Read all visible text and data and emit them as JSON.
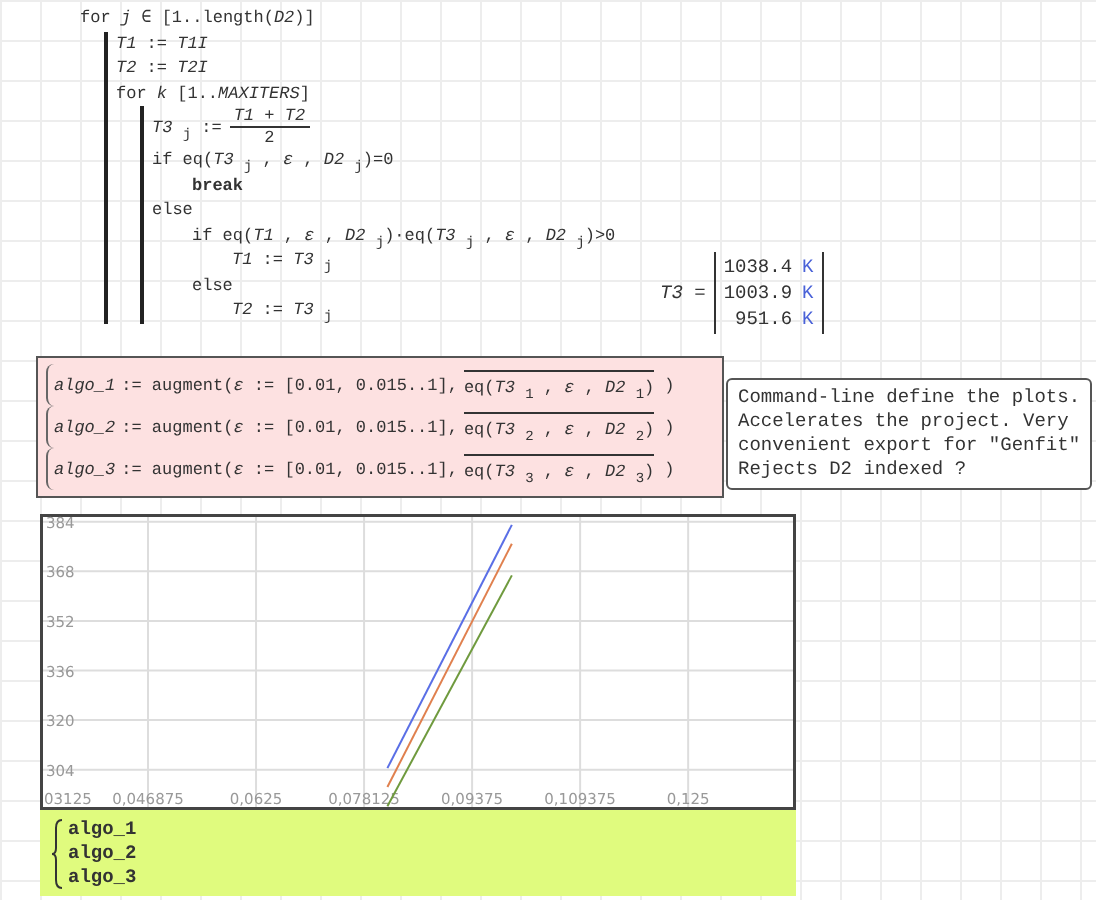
{
  "program": [
    {
      "kind": "loop",
      "text": "for *j* ∈ [1..length(*D2*)]",
      "children": [
        {
          "kind": "line",
          "text": "*T1* := *T1I*"
        },
        {
          "kind": "line",
          "text": "*T2* := *T2I*"
        },
        {
          "kind": "loop",
          "text": "for *k*   [1..*MAXITERS*]",
          "children": [
            {
              "kind": "fraction",
              "text": "*T3* $_{j}$ :=",
              "numerator": "*T1* + *T2*",
              "denominator": "2"
            },
            {
              "kind": "branch",
              "text": "if eq(*T3* $_{j}$ , *ε* , *D2* $_{j}$)=0",
              "children": [
                {
                  "kind": "keyword",
                  "text": "break"
                }
              ]
            },
            {
              "kind": "branch",
              "text": "else",
              "children": [
                {
                  "kind": "branch",
                  "text": "if eq(*T1* , *ε* , *D2* $_{j}$)·eq(*T3* $_{j}$ , *ε* , *D2* $_{j}$)>0",
                  "children": [
                    {
                      "kind": "line",
                      "text": "*T1* := *T3* $_{j}$"
                    }
                  ]
                },
                {
                  "kind": "branch",
                  "text": "else",
                  "children": [
                    {
                      "kind": "line",
                      "text": "*T2* := *T3* $_{j}$"
                    }
                  ]
                }
              ]
            }
          ]
        }
      ]
    }
  ],
  "result": {
    "name": "*T3* =",
    "rows": [
      {
        "value": "1038.4",
        "unit": "K"
      },
      {
        "value": "1003.9",
        "unit": "K"
      },
      {
        "value": "951.6",
        "unit": "K"
      }
    ]
  },
  "definitions": [
    {
      "name": "algo_1",
      "expression": ":= augment(*ε* := [0.01, 0.015..1],",
      "vectorized": "eq(*T3* $_{1}$ , *ε* , *D2* $_{1}$)",
      "closing": ")"
    },
    {
      "name": "algo_2",
      "expression": ":= augment(*ε* := [0.01, 0.015..1],",
      "vectorized": "eq(*T3* $_{2}$ , *ε* , *D2* $_{2}$)",
      "closing": ")"
    },
    {
      "name": "algo_3",
      "expression": ":= augment(*ε* := [0.01, 0.015..1],",
      "vectorized": "eq(*T3* $_{3}$ , *ε* , *D2* $_{3}$)",
      "closing": ")"
    }
  ],
  "note": {
    "text": "Command-line define the plots.\nAccelerates the project. Very\nconvenient export for \"Genfit\"\nRejects D2 indexed ?"
  },
  "plot": {
    "chart_data": {
      "type": "line",
      "x": [
        0.0815,
        0.0995
      ],
      "series": [
        {
          "name": "algo_1",
          "color": "#5a6fe6",
          "values": [
            304.5,
            383.0
          ]
        },
        {
          "name": "algo_2",
          "color": "#e0804e",
          "values": [
            298.4,
            376.9
          ]
        },
        {
          "name": "algo_3",
          "color": "#6f9a3e",
          "values": [
            292.2,
            366.7
          ]
        }
      ],
      "xlim": [
        0.03125,
        0.1406
      ],
      "ylim": [
        291,
        386.5
      ],
      "xticks": [
        {
          "value": 0.046875,
          "label": "0,046875"
        },
        {
          "value": 0.0625,
          "label": "0,0625"
        },
        {
          "value": 0.078125,
          "label": "0,078125"
        },
        {
          "value": 0.09375,
          "label": "0,09375"
        },
        {
          "value": 0.109375,
          "label": "0,109375"
        },
        {
          "value": 0.125,
          "label": "0,125"
        }
      ],
      "yticks": [
        304,
        320,
        336,
        352,
        368,
        384
      ],
      "grid": true
    },
    "cut_tick_label": "03125"
  }
}
